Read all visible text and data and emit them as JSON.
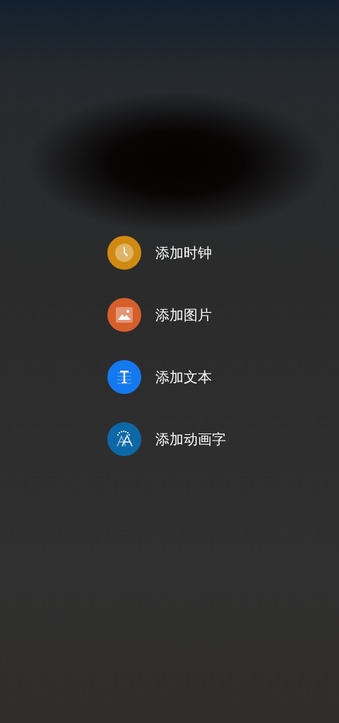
{
  "menu": [
    {
      "kind": "clock",
      "label": "添加时钟",
      "color": "#d08a12"
    },
    {
      "kind": "image",
      "label": "添加图片",
      "color": "#d65f2c"
    },
    {
      "kind": "text",
      "label": "添加文本",
      "color": "#1479ee"
    },
    {
      "kind": "animated",
      "label": "添加动画字",
      "color": "#0d68a8"
    }
  ]
}
